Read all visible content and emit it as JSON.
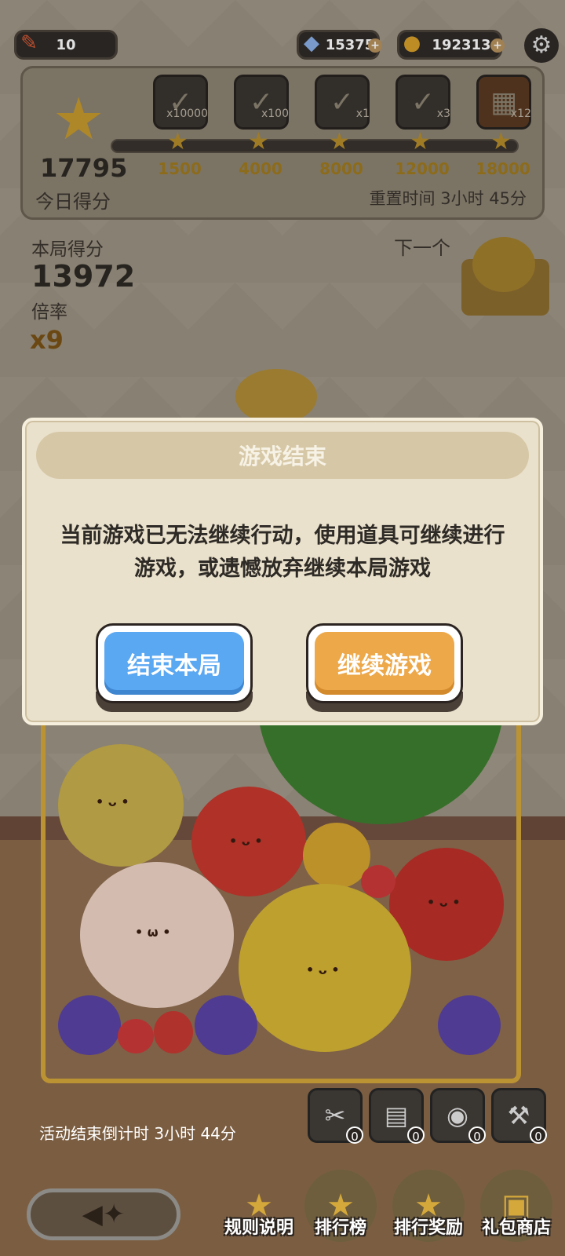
{
  "top_bar": {
    "energy": "10",
    "gems": "15375",
    "coins": "192313",
    "plus": "+"
  },
  "daily": {
    "score": "17795",
    "label": "今日得分",
    "reset": "重置时间 3小时 45分",
    "milestones": [
      {
        "threshold": "1500",
        "qty": "x10000"
      },
      {
        "threshold": "4000",
        "qty": "x100"
      },
      {
        "threshold": "8000",
        "qty": "x1"
      },
      {
        "threshold": "12000",
        "qty": "x3"
      },
      {
        "threshold": "18000",
        "qty": "x12"
      }
    ]
  },
  "round": {
    "score_label": "本局得分",
    "score": "13972",
    "multiplier_label": "倍率",
    "multiplier": "x9",
    "next_label": "下一个"
  },
  "modal": {
    "title": "游戏结束",
    "message": "当前游戏已无法继续行动，使用道具可继续进行游戏，或遗憾放弃继续本局游戏",
    "end_button": "结束本局",
    "continue_button": "继续游戏"
  },
  "bottom": {
    "countdown": "活动结束倒计时 3小时 44分",
    "tools": [
      {
        "icon": "magnet-icon",
        "count": "0"
      },
      {
        "icon": "card-icon",
        "count": "0"
      },
      {
        "icon": "orb-icon",
        "count": "0"
      },
      {
        "icon": "hammer-icon",
        "count": "0"
      }
    ],
    "nav": [
      "规则说明",
      "排行榜",
      "排行奖励",
      "礼包商店"
    ]
  },
  "colors": {
    "end_button": "#5aa7f2",
    "continue_button": "#eda84a",
    "modal_bg": "#eae1cc"
  }
}
